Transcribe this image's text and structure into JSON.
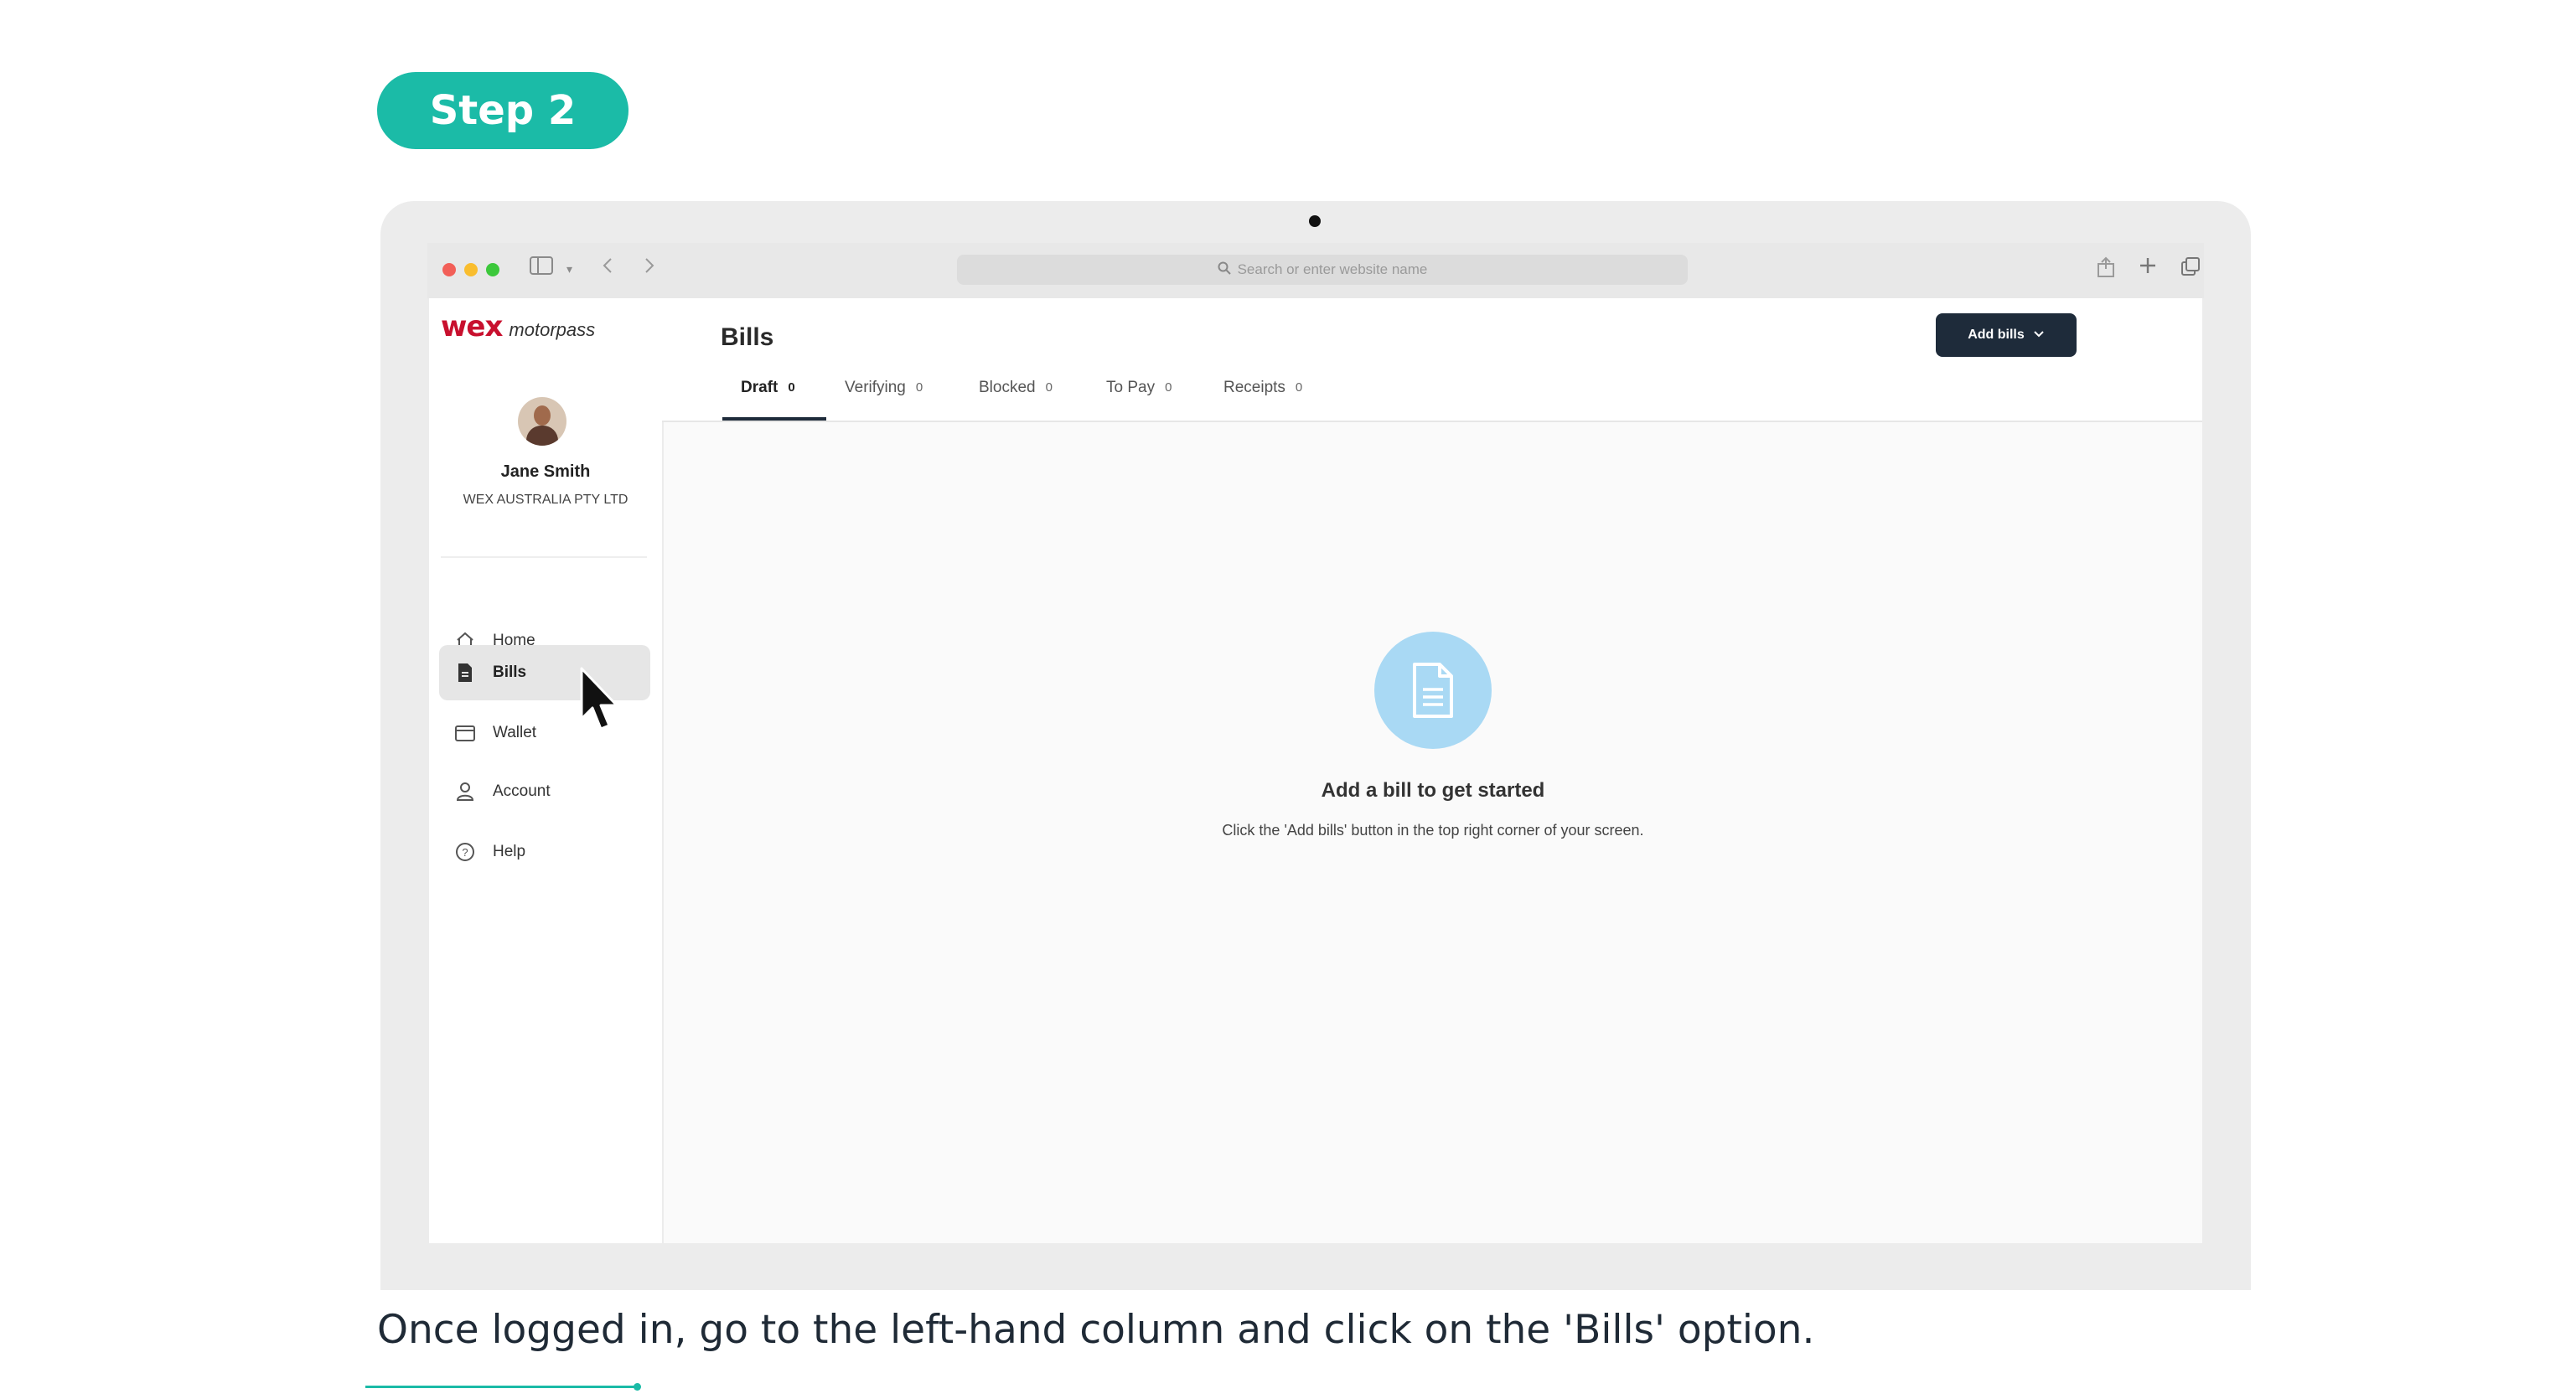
{
  "step": {
    "label": "Step 2"
  },
  "browser": {
    "url_placeholder": "Search or enter website name"
  },
  "app": {
    "logo_brand": "wex",
    "logo_product": "motorpass",
    "user": {
      "name": "Jane Smith",
      "org": "WEX AUSTRALIA PTY LTD"
    },
    "nav": [
      {
        "label": "Home",
        "icon": "home-icon"
      },
      {
        "label": "Bills",
        "icon": "bill-icon",
        "active": true
      },
      {
        "label": "Wallet",
        "icon": "wallet-icon"
      },
      {
        "label": "Account",
        "icon": "user-icon"
      },
      {
        "label": "Help",
        "icon": "help-icon"
      }
    ],
    "page_title": "Bills",
    "add_bills_label": "Add bills",
    "tabs": [
      {
        "label": "Draft",
        "count": "0",
        "active": true
      },
      {
        "label": "Verifying",
        "count": "0"
      },
      {
        "label": "Blocked",
        "count": "0"
      },
      {
        "label": "To Pay",
        "count": "0"
      },
      {
        "label": "Receipts",
        "count": "0"
      }
    ],
    "empty_state": {
      "title": "Add a bill to get started",
      "description": "Click the 'Add bills' button in the top right corner of your screen."
    }
  },
  "caption": "Once logged in, go to the left-hand column and click on the 'Bills' option.",
  "colors": {
    "accent": "#1bbba7",
    "brand_red": "#c8102e",
    "button_dark": "#1e2b3a",
    "empty_icon_bg": "#a9d9f4"
  }
}
